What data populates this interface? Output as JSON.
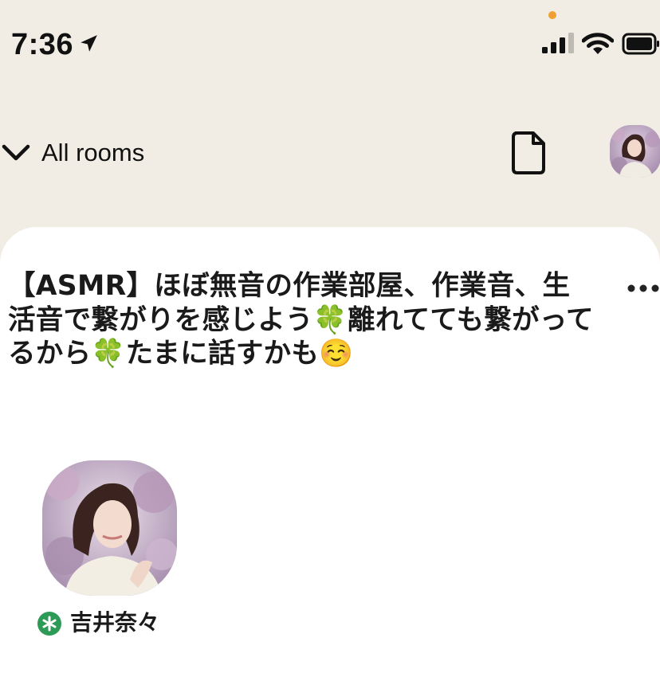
{
  "status_bar": {
    "time": "7:36",
    "location_icon": "location-arrow-icon",
    "signal_icon": "cellular-signal-icon",
    "wifi_icon": "wifi-icon",
    "battery_icon": "battery-icon",
    "privacy_indicator_color": "#f0a030"
  },
  "nav": {
    "back_icon": "chevron-down-icon",
    "back_label": "All rooms",
    "document_icon": "document-icon",
    "profile_avatar": "profile-avatar"
  },
  "room": {
    "title": "【ASMR】ほぼ無音の作業部屋、作業音、生活音で繋がりを感じよう🍀離れてても繋がってるから🍀たまに話すかも☺️",
    "more_icon": "more-horizontal-icon",
    "speakers": [
      {
        "name": "吉井奈々",
        "badge_icon": "moderator-star-icon",
        "badge_color": "#2e9a58"
      }
    ]
  },
  "colors": {
    "background": "#f1ede4",
    "sheet": "#ffffff",
    "text": "#111111"
  }
}
